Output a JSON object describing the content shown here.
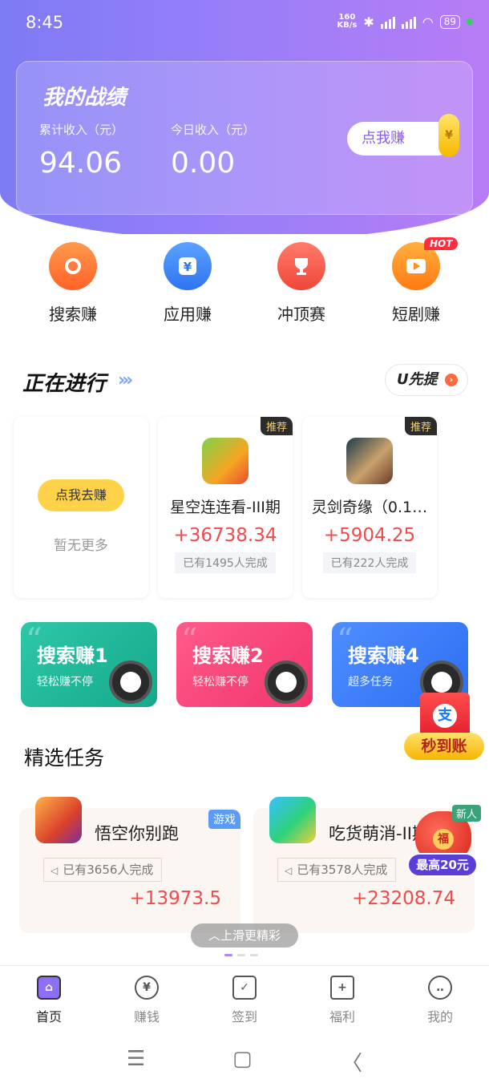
{
  "status": {
    "time": "8:45",
    "net_speed": "160\nKB/s",
    "battery": "89"
  },
  "summary": {
    "title": "我的战绩",
    "total_label": "累计收入（元）",
    "total_value": "94.06",
    "today_label": "今日收入（元）",
    "today_value": "0.00",
    "earn_button": "点我赚",
    "coin_symbol": "¥"
  },
  "quick_actions": [
    {
      "label": "搜索赚",
      "icon": "search-icon",
      "color": "#ff7a3d"
    },
    {
      "label": "应用赚",
      "icon": "download-icon",
      "color": "#3d8bff"
    },
    {
      "label": "冲顶赛",
      "icon": "trophy-icon",
      "color": "#ff5a4a"
    },
    {
      "label": "短剧赚",
      "icon": "play-icon",
      "color": "#ff8f1f",
      "badge": "HOT"
    }
  ],
  "in_progress": {
    "title": "正在进行",
    "chevrons": "›››",
    "u_button": "U先提",
    "empty_button": "点我去赚",
    "empty_text": "暂无更多",
    "tasks": [
      {
        "name": "星空连连看-III期",
        "amount": "+36738.34",
        "done": "已有1495人完成",
        "badge": "推荐"
      },
      {
        "name": "灵剑奇缘（0.1…",
        "amount": "+5904.25",
        "done": "已有222人完成",
        "badge": "推荐"
      }
    ]
  },
  "search_cards": [
    {
      "title": "搜索赚1",
      "sub": "轻松赚不停"
    },
    {
      "title": "搜索赚2",
      "sub": "轻松赚不停"
    },
    {
      "title": "搜索赚4",
      "sub": "超多任务"
    }
  ],
  "float_alipay": {
    "label": "秒到账",
    "glyph": "支"
  },
  "featured": {
    "title": "精选任务",
    "items": [
      {
        "name": "悟空你别跑",
        "tag": "游戏",
        "done": "已有3656人完成",
        "amount": "+13973.5"
      },
      {
        "name": "吃货萌消-II期",
        "tag": "",
        "done": "已有3578人完成",
        "amount": "+23208.74"
      }
    ]
  },
  "float_newuser": {
    "label": "新人",
    "glyph": "福",
    "max": "最高20元"
  },
  "slide_hint": "︿上滑更精彩",
  "nav": [
    {
      "label": "首页",
      "icon": "home-icon",
      "active": true
    },
    {
      "label": "赚钱",
      "icon": "yen-icon"
    },
    {
      "label": "签到",
      "icon": "calendar-check-icon"
    },
    {
      "label": "福利",
      "icon": "gift-icon"
    },
    {
      "label": "我的",
      "icon": "profile-icon"
    }
  ],
  "system_nav": {
    "menu": "☰",
    "home": "▢",
    "back": "〈"
  }
}
